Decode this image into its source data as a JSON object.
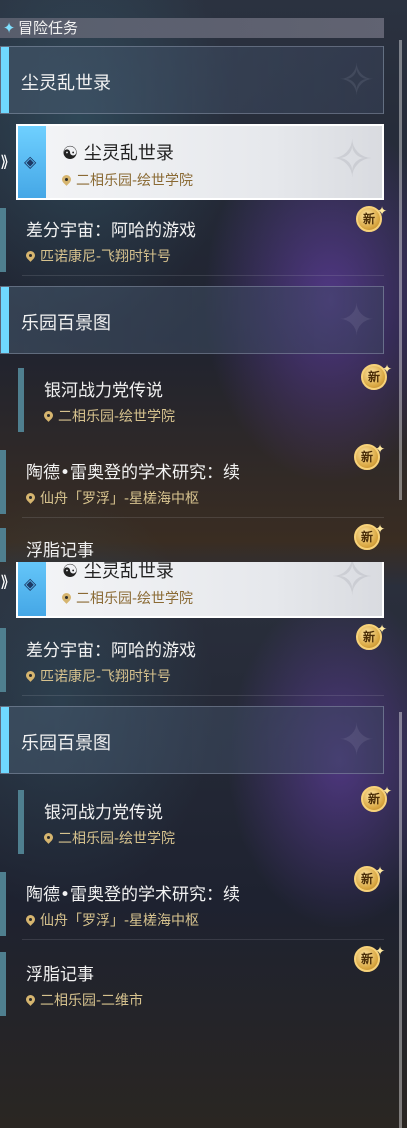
{
  "header": {
    "icon": "diamond-icon",
    "title": "冒险任务"
  },
  "category1": {
    "title": "尘灵乱世录"
  },
  "selected": {
    "title": "尘灵乱世录",
    "icon": "quest-type-icon",
    "location": "二相乐园-绘世学院"
  },
  "item_diff": {
    "title": "差分宇宙：阿哈的游戏",
    "location": "匹诺康尼-飞翔时针号",
    "badge": "新"
  },
  "category2": {
    "title": "乐园百景图"
  },
  "item_galaxy": {
    "title": "银河战力党传说",
    "location": "二相乐园-绘世学院",
    "badge": "新"
  },
  "item_tao": {
    "title": "陶德•雷奥登的学术研究：续",
    "location": "仙舟「罗浮」-星槎海中枢",
    "badge": "新"
  },
  "item_fuzhi": {
    "title": "浮脂记事",
    "location": "二相乐园-二维市",
    "badge": "新"
  },
  "colors": {
    "accent": "#6fd8ff",
    "badge": "#d8a640",
    "location_text": "#d6c28e"
  }
}
